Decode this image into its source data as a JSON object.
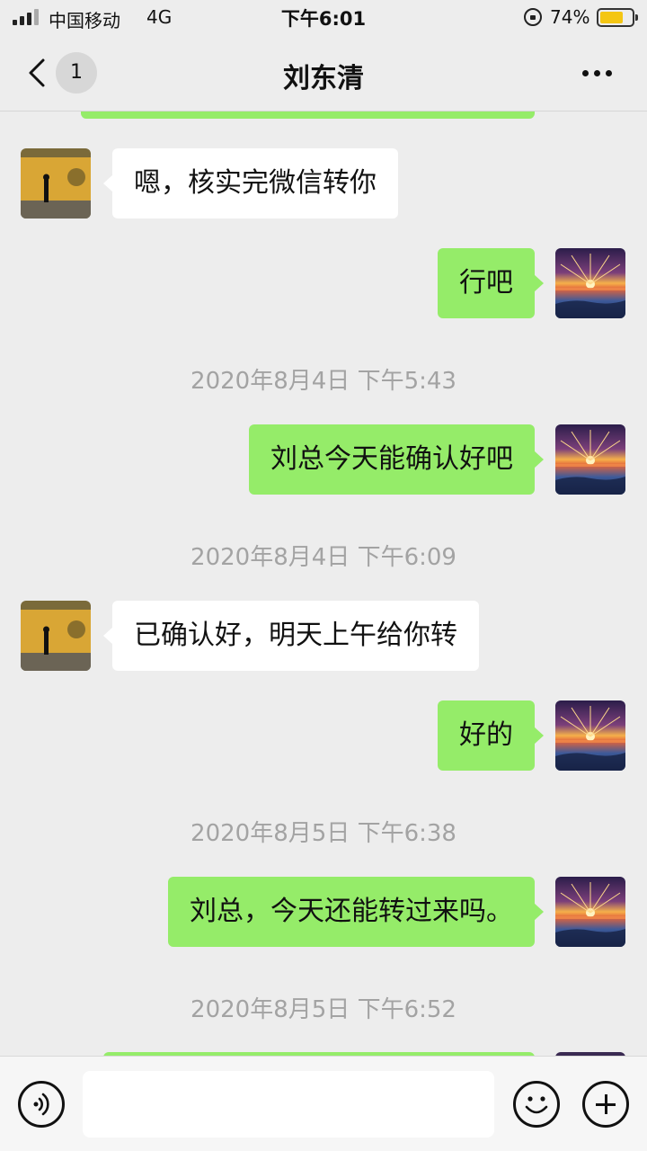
{
  "status_bar": {
    "carrier": "中国移动",
    "network": "4G",
    "time": "下午6:01",
    "battery_percent_text": "74%",
    "battery_level": 0.74,
    "battery_color": "#f4c613"
  },
  "nav": {
    "back_icon": "chevron-left-icon",
    "unread_count": "1",
    "title": "刘东清",
    "more_icon": "ellipsis-icon"
  },
  "colors": {
    "background": "#ededed",
    "sent_bubble": "#95ec69",
    "received_bubble": "#ffffff",
    "timestamp_text": "#a3a3a3"
  },
  "messages": [
    {
      "type": "received",
      "text": "嗯，核实完微信转你"
    },
    {
      "type": "sent",
      "text": "行吧"
    },
    {
      "type": "time",
      "text": "2020年8月4日 下午5:43"
    },
    {
      "type": "sent",
      "text": "刘总今天能确认好吧"
    },
    {
      "type": "time",
      "text": "2020年8月4日 下午6:09"
    },
    {
      "type": "received",
      "text": "已确认好，明天上午给你转"
    },
    {
      "type": "sent",
      "text": "好的"
    },
    {
      "type": "time",
      "text": "2020年8月5日 下午6:38"
    },
    {
      "type": "sent",
      "text": "刘总，今天还能转过来吗。"
    },
    {
      "type": "time",
      "text": "2020年8月5日 下午6:52"
    }
  ],
  "input_bar": {
    "voice_icon": "voice-icon",
    "text_value": "",
    "emoji_icon": "emoji-icon",
    "plus_icon": "plus-icon"
  }
}
